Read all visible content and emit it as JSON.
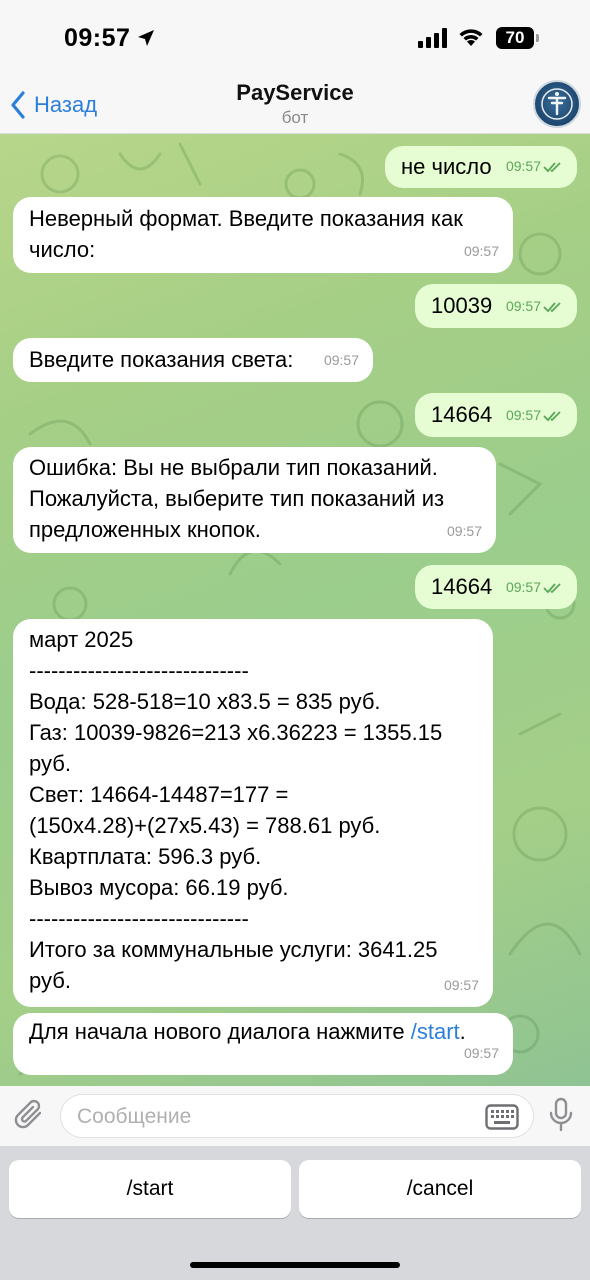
{
  "status_bar": {
    "time": "09:57",
    "battery": "70"
  },
  "header": {
    "back_label": "Назад",
    "title": "PayService",
    "subtitle": "бот"
  },
  "messages": [
    {
      "direction": "out",
      "text": "не число",
      "time": "09:57"
    },
    {
      "direction": "in",
      "text": "Неверный формат. Введите показания как\nчисло:",
      "time": "09:57"
    },
    {
      "direction": "out",
      "text": "10039",
      "time": "09:57"
    },
    {
      "direction": "in",
      "text": "Введите показания света:",
      "time": "09:57"
    },
    {
      "direction": "out",
      "text": "14664",
      "time": "09:57"
    },
    {
      "direction": "in",
      "text": "Ошибка: Вы не выбрали тип показаний.\nПожалуйста, выберите тип показаний из\nпредложенных кнопок.",
      "time": "09:57"
    },
    {
      "direction": "out",
      "text": "14664",
      "time": "09:57"
    },
    {
      "direction": "in",
      "text": "март 2025\n------------------------------\nВода: 528-518=10 x83.5 = 835 руб.\nГаз: 10039-9826=213 x6.36223 = 1355.15\nруб.\nСвет: 14664-14487=177 =\n(150x4.28)+(27x5.43) = 788.61 руб.\nКвартплата: 596.3 руб.\nВывоз мусора: 66.19 руб.\n------------------------------\nИтого за коммунальные услуги: 3641.25\nруб.",
      "time": "09:57"
    },
    {
      "direction": "in",
      "text_before_link": "Для начала нового диалога нажмите ",
      "link": "/start",
      "text_after_link": ".",
      "time": "09:57"
    }
  ],
  "input": {
    "placeholder": "Сообщение"
  },
  "bot_keyboard": {
    "buttons": [
      "/start",
      "/cancel"
    ]
  },
  "colors": {
    "accent": "#2c7fd8",
    "outgoing_bubble": "#e6fcd2",
    "incoming_bubble": "#ffffff",
    "read_check": "#5aa85a"
  },
  "icons": [
    "location-arrow-icon",
    "signal-icon",
    "wifi-icon",
    "chevron-left-icon",
    "paperclip-icon",
    "keyboard-icon",
    "microphone-icon",
    "double-check-icon"
  ]
}
